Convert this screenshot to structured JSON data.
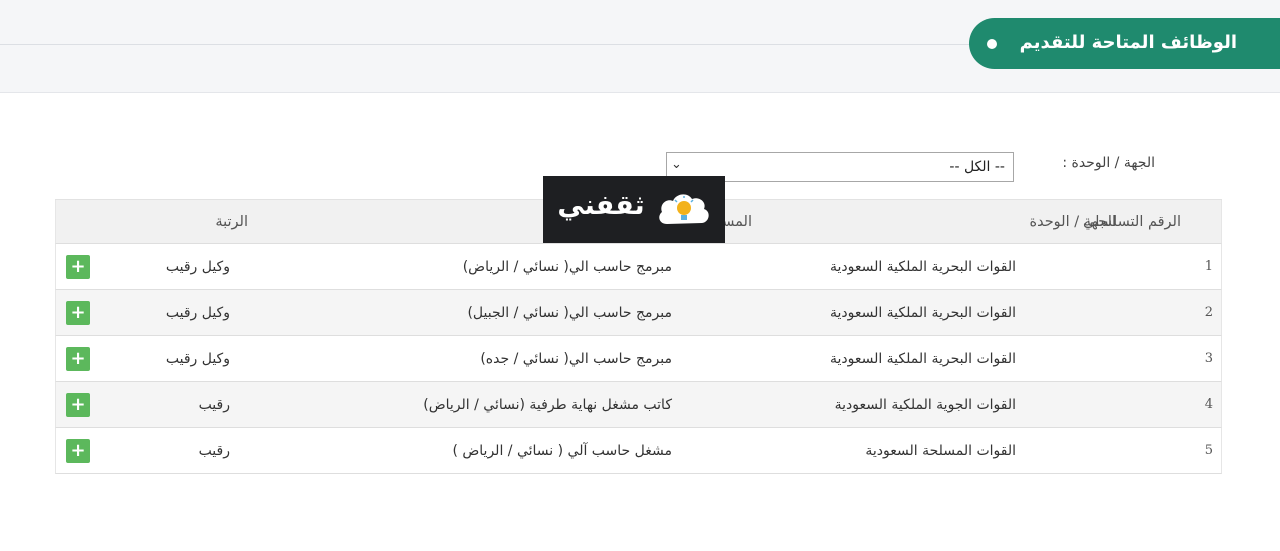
{
  "header": {
    "title": "الوظائف المتاحة للتقديم"
  },
  "filter": {
    "label": "الجهة / الوحدة :",
    "selected": "-- الكل --"
  },
  "logo": {
    "text": "ثقفني"
  },
  "table": {
    "columns": [
      "الرقم التسلسلي",
      "الجهة / الوحدة",
      "المسمى الوظيفي",
      "الرتبة"
    ],
    "rows": [
      {
        "num": "1",
        "unit": "القوات البحرية الملكية السعودية",
        "job": "مبرمج حاسب الي( نسائي / الرياض)",
        "rank": "وكيل رقيب"
      },
      {
        "num": "2",
        "unit": "القوات البحرية الملكية السعودية",
        "job": "مبرمج حاسب الي( نسائي / الجبيل)",
        "rank": "وكيل رقيب"
      },
      {
        "num": "3",
        "unit": "القوات البحرية الملكية السعودية",
        "job": "مبرمج حاسب الي( نسائي / جده)",
        "rank": "وكيل رقيب"
      },
      {
        "num": "4",
        "unit": "القوات الجوية الملكية السعودية",
        "job": "كاتب مشغل نهاية طرفية (نسائي / الرياض)",
        "rank": "رقيب"
      },
      {
        "num": "5",
        "unit": "القوات المسلحة السعودية",
        "job": "مشغل حاسب آلي ( نسائي / الرياض )",
        "rank": "رقيب"
      }
    ],
    "add_label": "+"
  },
  "colors": {
    "title_bg": "#1f8a6e",
    "add_button": "#5cb85c"
  }
}
